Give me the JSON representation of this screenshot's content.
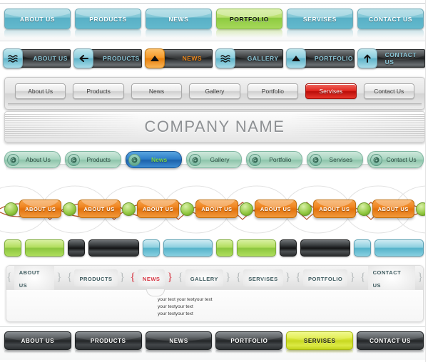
{
  "rows": {
    "teal_tabs": {
      "name": "Teal glossy tab bar",
      "accent": "#63b9cd",
      "active_accent": "#a6d85a",
      "items": [
        {
          "label": "ABOUT US",
          "active": false
        },
        {
          "label": "PRODUCTS",
          "active": false
        },
        {
          "label": "NEWS",
          "active": false
        },
        {
          "label": "PORTFOLIO",
          "active": true
        },
        {
          "label": "SERVISES",
          "active": false
        },
        {
          "label": "CONTACT US",
          "active": false
        }
      ]
    },
    "dark_icon_bar": {
      "name": "Dark metal bar with icon squares",
      "accent": "#8cc7d8",
      "active_accent": "#f08a1c",
      "items": [
        {
          "label": "ABOUT US",
          "icon": "waves-icon",
          "active": false
        },
        {
          "label": "PRODUCTS",
          "icon": "arrow-left-icon",
          "active": false
        },
        {
          "label": "NEWS",
          "icon": "triangle-up-icon",
          "active": true
        },
        {
          "label": "GALLERY",
          "icon": "waves-icon",
          "active": false
        },
        {
          "label": "PORTFOLIO",
          "icon": "triangle-up-icon",
          "active": false
        },
        {
          "label": "CONTACT US",
          "icon": "arrow-up-icon",
          "active": false
        }
      ]
    },
    "grey_buttons": {
      "name": "Light grey rounded button bar",
      "active_accent": "#d0211a",
      "items": [
        {
          "label": "About Us",
          "active": false
        },
        {
          "label": "Products",
          "active": false
        },
        {
          "label": "News",
          "active": false
        },
        {
          "label": "Gallery",
          "active": false
        },
        {
          "label": "Portfolio",
          "active": false
        },
        {
          "label": "Servises",
          "active": true
        },
        {
          "label": "Contact Us",
          "active": false
        }
      ]
    },
    "banner": {
      "name": "Company name banner",
      "title": "COMPANY NAME"
    },
    "green_pills": {
      "name": "Green glossy pills with spiral icons",
      "accent": "#a9d6c1",
      "active_accent": "#2f7fc9",
      "active_text": "#7ed94a",
      "items": [
        {
          "label": "About Us",
          "icon": "spiral-icon",
          "active": false
        },
        {
          "label": "Products",
          "icon": "spiral-icon",
          "active": false
        },
        {
          "label": "News",
          "icon": "spiral-icon",
          "active": true
        },
        {
          "label": "Gallery",
          "icon": "spiral-icon",
          "active": false
        },
        {
          "label": "Portfolio",
          "icon": "spiral-icon",
          "active": false
        },
        {
          "label": "Servises",
          "icon": "spiral-icon",
          "active": false
        },
        {
          "label": "Contact Us",
          "icon": "spiral-icon",
          "active": false
        }
      ]
    },
    "orange_buttons": {
      "name": "Orange buttons over decorative rings",
      "accent": "#ef8420",
      "dot_color": "#8fc63d",
      "items": [
        {
          "label": "ABOUT US"
        },
        {
          "label": "ABOUT US"
        },
        {
          "label": "ABOUT US"
        },
        {
          "label": "ABOUT US"
        },
        {
          "label": "ABOUT US"
        },
        {
          "label": "ABOUT US"
        },
        {
          "label": "ABOUT US"
        }
      ]
    },
    "blank_chips": {
      "name": "Blank glossy button blanks",
      "colors": {
        "green": "#8cc63f",
        "dark": "#232628",
        "teal": "#55b3ca"
      },
      "sets": [
        {
          "color": "green"
        },
        {
          "color": "dark"
        },
        {
          "color": "teal"
        },
        {
          "color": "green"
        },
        {
          "color": "dark"
        },
        {
          "color": "teal"
        }
      ]
    },
    "bracket_nav": {
      "name": "Bracket style navigation panel",
      "accent": "#3d5a5e",
      "active_accent": "#d6323f",
      "bracket_open": "{",
      "bracket_close": "}",
      "items": [
        {
          "label": "ABOUT US",
          "active": false
        },
        {
          "label": "PRODUCTS",
          "active": false
        },
        {
          "label": "NEWS",
          "active": true
        },
        {
          "label": "GALLERY",
          "active": false
        },
        {
          "label": "SERVISES",
          "active": false
        },
        {
          "label": "PORTFOLIO",
          "active": false
        },
        {
          "label": "CONTACT US",
          "active": false
        }
      ],
      "content_lines": [
        "your text your textyour text",
        "your textyour text",
        "your textyour text"
      ]
    },
    "dark_tabs": {
      "name": "Dark glossy bottom tab bar",
      "accent": "#232628",
      "active_accent": "#c8d820",
      "items": [
        {
          "label": "ABOUT US",
          "active": false
        },
        {
          "label": "PRODUCTS",
          "active": false
        },
        {
          "label": "NEWS",
          "active": false
        },
        {
          "label": "PORTFOLIO",
          "active": false
        },
        {
          "label": "SERVISES",
          "active": true
        },
        {
          "label": "CONTACT US",
          "active": false
        }
      ]
    }
  }
}
